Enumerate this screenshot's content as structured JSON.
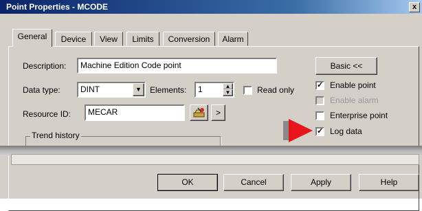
{
  "window": {
    "title": "Point Properties - MCODE",
    "close_glyph": "x"
  },
  "tabs": [
    {
      "label": "General",
      "active": true
    },
    {
      "label": "Device"
    },
    {
      "label": "View"
    },
    {
      "label": "Limits"
    },
    {
      "label": "Conversion"
    },
    {
      "label": "Alarm"
    }
  ],
  "general": {
    "description_label": "Description:",
    "description_value": "Machine Edition Code point",
    "data_type_label": "Data type:",
    "data_type_value": "DINT",
    "elements_label": "Elements:",
    "elements_value": "1",
    "read_only_label": "Read only",
    "read_only_checked": false,
    "resource_id_label": "Resource ID:",
    "resource_id_value": "MECAR",
    "resource_next_glyph": ">",
    "trend_history_label": "Trend history"
  },
  "options": {
    "basic_button": "Basic <<",
    "checkboxes": [
      {
        "label": "Enable point",
        "checked": true,
        "enabled": true
      },
      {
        "label": "Enable alarm",
        "checked": false,
        "enabled": false
      },
      {
        "label": "Enterprise point",
        "checked": false,
        "enabled": true
      },
      {
        "label": "Log data",
        "checked": true,
        "enabled": true
      }
    ]
  },
  "footer": {
    "ok": "OK",
    "cancel": "Cancel",
    "apply": "Apply",
    "help": "Help"
  },
  "colors": {
    "annotation_arrow": "#e8141c",
    "title_bar": "#0a246a"
  },
  "icons": {
    "resource_browse": "resource-browse-icon",
    "pointer": "red-arrow-icon"
  }
}
